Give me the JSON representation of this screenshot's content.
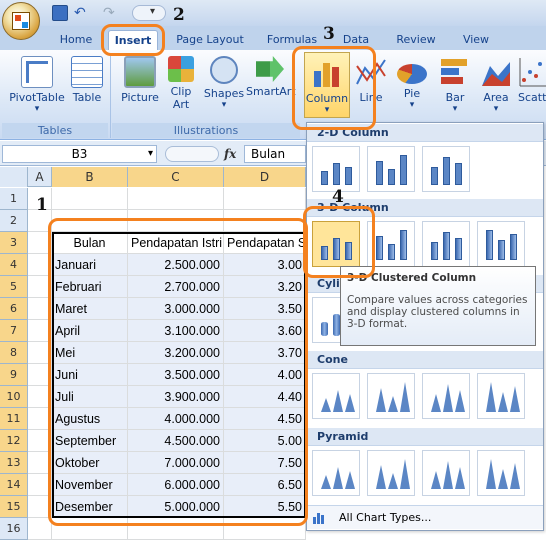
{
  "ribbon": {
    "tabs": [
      "Home",
      "Insert",
      "Page Layout",
      "Formulas",
      "Data",
      "Review",
      "View"
    ],
    "buttons": {
      "pivottable": "PivotTable",
      "table": "Table",
      "picture": "Picture",
      "clipart_line1": "Clip",
      "clipart_line2": "Art",
      "shapes": "Shapes",
      "smartart": "SmartArt",
      "column": "Column",
      "line": "Line",
      "pie": "Pie",
      "bar": "Bar",
      "area": "Area",
      "scatter": "Scatt"
    },
    "groups": {
      "tables": "Tables",
      "illustrations": "Illustrations"
    }
  },
  "formula_bar": {
    "name_box": "B3",
    "fx": "fx",
    "content": "Bulan"
  },
  "grid": {
    "columns": [
      "A",
      "B",
      "C",
      "D"
    ],
    "rows": [
      "1",
      "2",
      "3",
      "4",
      "5",
      "6",
      "7",
      "8",
      "9",
      "10",
      "11",
      "12",
      "13",
      "14",
      "15",
      "16"
    ],
    "headers": {
      "b": "Bulan",
      "c": "Pendapatan Istri",
      "d": "Pendapatan S"
    },
    "data": [
      {
        "month": "Januari",
        "istri": "2.500.000",
        "suami": "3.00"
      },
      {
        "month": "Februari",
        "istri": "2.700.000",
        "suami": "3.20"
      },
      {
        "month": "Maret",
        "istri": "3.000.000",
        "suami": "3.50"
      },
      {
        "month": "April",
        "istri": "3.100.000",
        "suami": "3.60"
      },
      {
        "month": "Mei",
        "istri": "3.200.000",
        "suami": "3.70"
      },
      {
        "month": "Juni",
        "istri": "3.500.000",
        "suami": "4.00"
      },
      {
        "month": "Juli",
        "istri": "3.900.000",
        "suami": "4.40"
      },
      {
        "month": "Agustus",
        "istri": "4.000.000",
        "suami": "4.50"
      },
      {
        "month": "September",
        "istri": "4.500.000",
        "suami": "5.00"
      },
      {
        "month": "Oktober",
        "istri": "7.000.000",
        "suami": "7.50"
      },
      {
        "month": "November",
        "istri": "6.000.000",
        "suami": "6.50"
      },
      {
        "month": "Desember",
        "istri": "5.000.000",
        "suami": "5.50"
      }
    ]
  },
  "dropdown": {
    "sections": {
      "col2d": "2-D Column",
      "col3d": "3-D Column",
      "cylinder": "Cylin",
      "cone": "Cone",
      "pyramid": "Pyramid"
    },
    "all_chart_types": "All Chart Types..."
  },
  "tooltip": {
    "title": "3-D Clustered Column",
    "body": "Compare values across categories and display clustered columns in 3-D format."
  },
  "annotations": {
    "n1": "1",
    "n2": "2",
    "n3": "3",
    "n4": "4"
  }
}
